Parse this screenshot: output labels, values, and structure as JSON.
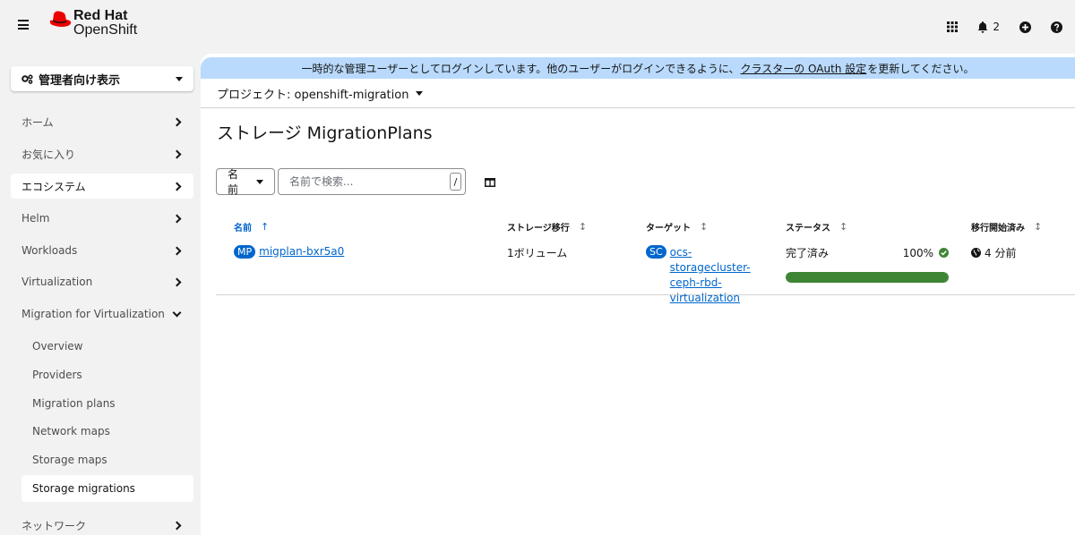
{
  "masthead": {
    "brand": "Red Hat",
    "product": "OpenShift",
    "notification_count": "2",
    "icons": [
      "apps-grid-icon",
      "bell-icon",
      "plus-circle-icon",
      "help-icon"
    ]
  },
  "perspective": {
    "label": "管理者向け表示"
  },
  "sidebar": {
    "items": [
      {
        "label": "ホーム"
      },
      {
        "label": "お気に入り"
      },
      {
        "label": "エコシステム"
      },
      {
        "label": "Helm"
      },
      {
        "label": "Workloads"
      },
      {
        "label": "Virtualization"
      },
      {
        "label": "Migration for Virtualization"
      },
      {
        "label": "ネットワーク"
      }
    ],
    "subitems": [
      {
        "label": "Overview"
      },
      {
        "label": "Providers"
      },
      {
        "label": "Migration plans"
      },
      {
        "label": "Network maps"
      },
      {
        "label": "Storage maps"
      },
      {
        "label": "Storage migrations"
      }
    ]
  },
  "banner": {
    "text_before": "一時的な管理ユーザーとしてログインしています。他のユーザーがログインできるように、",
    "link_text": "クラスターの OAuth 設定",
    "text_after": "を更新してください。"
  },
  "project": {
    "label": "プロジェクト: openshift-migration"
  },
  "page": {
    "title": "ストレージ MigrationPlans"
  },
  "filter": {
    "label": "名前",
    "placeholder": "名前で検索...",
    "shortcut": "/"
  },
  "table": {
    "columns": [
      {
        "label": "名前"
      },
      {
        "label": "ストレージ移行"
      },
      {
        "label": "ターゲット"
      },
      {
        "label": "ステータス"
      },
      {
        "label": "移行開始済み"
      }
    ],
    "rows": [
      {
        "name_badge": "MP",
        "name": "migplan-bxr5a0",
        "storage": "1ボリューム",
        "target_badge": "SC",
        "target": "ocs-storagecluster-ceph-rbd-virtualization",
        "status": "完了済み",
        "progress_text": "100%",
        "progress_percent": 100,
        "started": "4 分前"
      }
    ]
  },
  "colors": {
    "accent": "#0066cc",
    "success": "#3e8635",
    "banner": "#b9dafc",
    "brand_red": "#ee0000"
  }
}
